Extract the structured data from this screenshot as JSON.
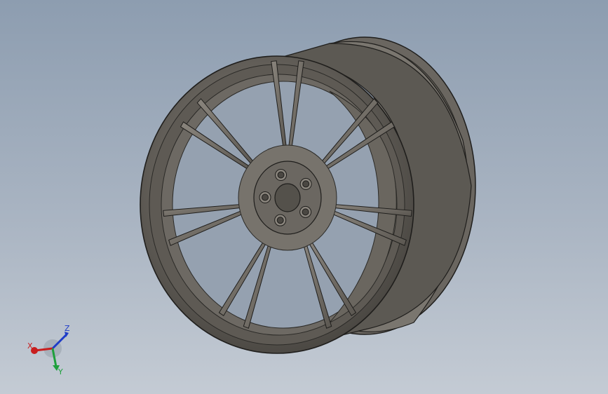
{
  "viewport": {
    "background_top": "#8d9db0",
    "background_bottom": "#c4cbd4"
  },
  "model": {
    "spoke_pairs": 7,
    "lug_holes": 5,
    "body_color": "#615d57",
    "edge_color": "#1f1e1c"
  },
  "triad": {
    "x_label": "X",
    "y_label": "Y",
    "z_label": "Z",
    "x_color": "#c81e1e",
    "y_color": "#1ea03c",
    "z_color": "#1e3cc8"
  }
}
